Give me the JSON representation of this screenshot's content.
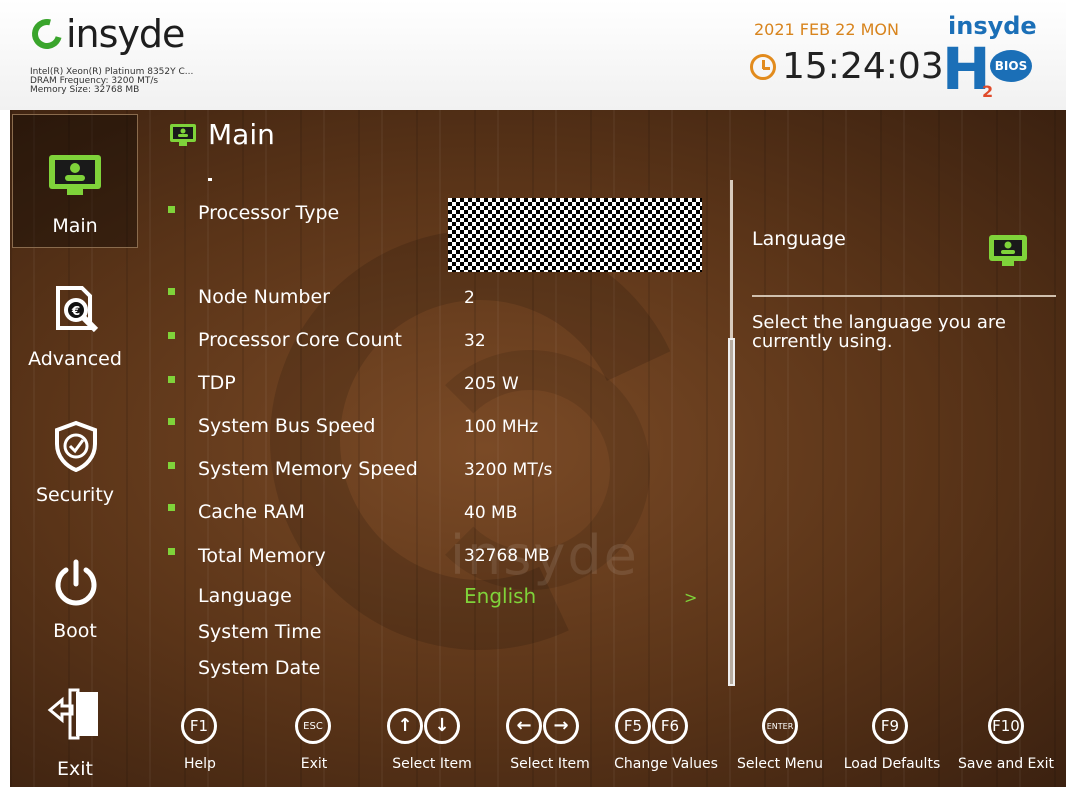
{
  "header": {
    "logo_text": "insyde",
    "cpu_info": [
      "Intel(R) Xeon(R) Platinum 8352Y C...",
      "DRAM Frequency: 3200 MT/s",
      "Memory Size: 32768 MB"
    ],
    "date": "2021 FEB 22 MON",
    "time": "15:24:03",
    "brand_word": "insyde",
    "brand_h": "H",
    "brand_2": "2",
    "brand_bios": "BIOS"
  },
  "sidebar": {
    "items": [
      {
        "label": "Main"
      },
      {
        "label": "Advanced"
      },
      {
        "label": "Security"
      },
      {
        "label": "Boot"
      },
      {
        "label": "Exit"
      }
    ]
  },
  "main": {
    "title": "Main",
    "rows": [
      {
        "label": "Processor Type",
        "value": ""
      },
      {
        "label": "Node Number",
        "value": "2"
      },
      {
        "label": "Processor Core Count",
        "value": "32"
      },
      {
        "label": "TDP",
        "value": "205 W"
      },
      {
        "label": "System Bus Speed",
        "value": "100 MHz"
      },
      {
        "label": "System Memory Speed",
        "value": "3200 MT/s"
      },
      {
        "label": "Cache RAM",
        "value": "40 MB"
      },
      {
        "label": "Total Memory",
        "value": "32768 MB"
      },
      {
        "label": "Language",
        "value": "English",
        "arrow": ">"
      },
      {
        "label": "System Time",
        "value": ""
      },
      {
        "label": "System Date",
        "value": ""
      }
    ]
  },
  "help": {
    "title": "Language",
    "text": "Select the language you are currently using."
  },
  "footer": {
    "keys": [
      {
        "keys": [
          "F1"
        ],
        "label": "Help"
      },
      {
        "keys": [
          "ESC"
        ],
        "label": "Exit"
      },
      {
        "keys": [
          "↑",
          "↓"
        ],
        "label": "Select Item"
      },
      {
        "keys": [
          "←",
          "→"
        ],
        "label": "Select Item"
      },
      {
        "keys": [
          "F5",
          "F6"
        ],
        "label": "Change Values"
      },
      {
        "keys": [
          "ENTER"
        ],
        "label": "Select Menu"
      },
      {
        "keys": [
          "F9"
        ],
        "label": "Load Defaults"
      },
      {
        "keys": [
          "F10"
        ],
        "label": "Save and Exit"
      }
    ]
  },
  "colors": {
    "accent_green": "#7fd33a",
    "date_orange": "#d8841d",
    "brand_blue": "#1b6fb7"
  },
  "icons": [
    "main-monitor-icon",
    "advanced-search-doc-icon",
    "security-shield-icon",
    "boot-power-icon",
    "exit-door-icon",
    "clock-icon"
  ]
}
